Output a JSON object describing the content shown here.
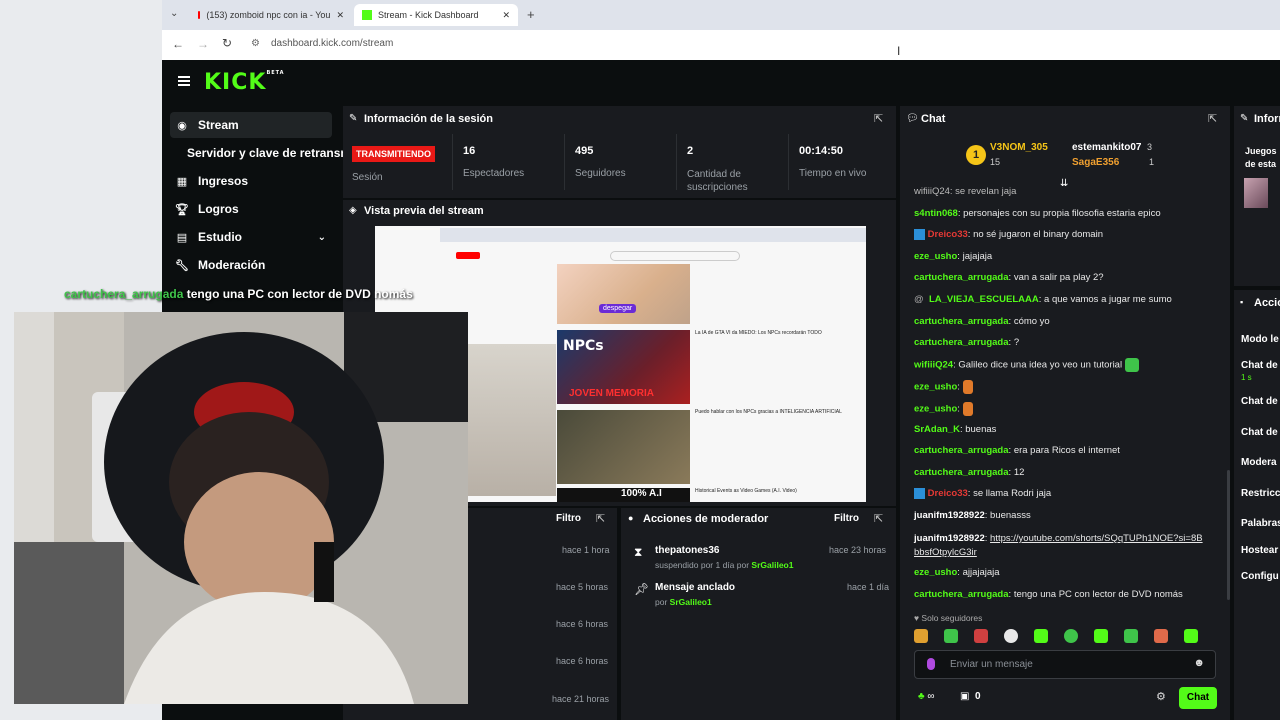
{
  "browser": {
    "tabs": [
      {
        "label": "(153) zomboid npc con ia - You",
        "active": false
      },
      {
        "label": "Stream - Kick Dashboard",
        "active": true
      }
    ],
    "new_tab": "+",
    "url": "dashboard.kick.com/stream"
  },
  "brand": {
    "logo": "KICK",
    "beta": "BETA",
    "accent": "#53fc18"
  },
  "sidebar": {
    "items": [
      {
        "label": "Stream",
        "icon": "stream-icon"
      },
      {
        "label": "Servidor y clave de retransm",
        "icon": ""
      },
      {
        "label": "Ingresos",
        "icon": "revenue-icon"
      },
      {
        "label": "Logros",
        "icon": "trophy-icon"
      },
      {
        "label": "Estudio",
        "icon": "studio-icon"
      },
      {
        "label": "Moderación",
        "icon": "wrench-icon"
      }
    ]
  },
  "session": {
    "title": "Información de la sesión",
    "status_badge": "TRANSMITIENDO",
    "status_label": "Sesión",
    "stats": [
      {
        "value": "16",
        "label": "Espectadores"
      },
      {
        "value": "495",
        "label": "Seguidores"
      },
      {
        "value": "2",
        "label": "Cantidad de suscripciones"
      },
      {
        "value": "00:14:50",
        "label": "Tiempo en vivo"
      }
    ]
  },
  "preview": {
    "title": "Vista previa del stream",
    "thumbs": [
      "despegar",
      "NPCs",
      "JOVEN MEMORIA",
      "100% A.I"
    ],
    "video_titles": [
      "La IA de GTA VI da MIEDO: Los NPCs recordarán TODO",
      "Puedo hablar con los NPCs gracias a INTELIGENCIA ARTIFICIAL",
      "Historical Events as Video Games (A.I. Video)"
    ]
  },
  "activity": {
    "filter": "Filtro",
    "times": [
      "hace 1 hora",
      "hace 5 horas",
      "hace 6 horas",
      "hace 6 horas",
      "hace 21 horas"
    ]
  },
  "mod_actions": {
    "title": "Acciones de moderador",
    "filter": "Filtro",
    "items": [
      {
        "user": "thepatones36",
        "detail": "suspendido por 1 día por",
        "by": "SrGalileo1",
        "time": "hace 23 horas"
      },
      {
        "user": "Mensaje anclado",
        "detail": "por",
        "by": "SrGalileo1",
        "time": "hace 1 día"
      }
    ]
  },
  "chat": {
    "title": "Chat",
    "top_gifter": {
      "rank": "1",
      "name": "V3NOM_305",
      "count": "15"
    },
    "gifters": [
      {
        "name": "estemankito07",
        "count": "3"
      },
      {
        "name": "SagaE356",
        "count": "1"
      }
    ],
    "partial_top": "wifiiiQ24: se revelan jaja",
    "messages": [
      {
        "user": "s4ntin068",
        "text": "personajes con su propia filosofia estaria epico",
        "color": "green"
      },
      {
        "user": "Dreico33",
        "text": "no sé jugaron el binary domain",
        "color": "red"
      },
      {
        "user": "eze_usho",
        "text": "jajajaja",
        "color": "green"
      },
      {
        "user": "cartuchera_arrugada",
        "text": "van a salir pa play 2?",
        "color": "green"
      },
      {
        "user": "LA_VIEJA_ESCUELAAA",
        "text": "a que vamos a jugar me sumo",
        "color": "green"
      },
      {
        "user": "cartuchera_arrugada",
        "text": "cómo yo",
        "color": "green"
      },
      {
        "user": "cartuchera_arrugada",
        "text": "?",
        "color": "green"
      },
      {
        "user": "wifiiiQ24",
        "text": "Galileo dice una idea yo veo un tutorial",
        "color": "green"
      },
      {
        "user": "eze_usho",
        "text": "",
        "color": "green"
      },
      {
        "user": "eze_usho",
        "text": "",
        "color": "green"
      },
      {
        "user": "SrAdan_K",
        "text": "buenas",
        "color": "green"
      },
      {
        "user": "cartuchera_arrugada",
        "text": "era para Ricos el internet",
        "color": "green"
      },
      {
        "user": "cartuchera_arrugada",
        "text": "12",
        "color": "green"
      },
      {
        "user": "Dreico33",
        "text": "se llama Rodri jaja",
        "color": "red"
      },
      {
        "user": "juanifm1928922",
        "text": "buenasss",
        "color": "white"
      },
      {
        "user": "juanifm1928922",
        "text": "https://youtube.com/shorts/SQqTUPh1NOE?si=8BbbsfOtpylcG3ir",
        "color": "white"
      },
      {
        "user": "eze_usho",
        "text": "ajjajajaja",
        "color": "green"
      },
      {
        "user": "cartuchera_arrugada",
        "text": "tengo una PC con lector de DVD nomás",
        "color": "green"
      }
    ],
    "followers_only": "Solo seguidores",
    "input_placeholder": "Enviar un mensaje",
    "send_label": "Chat",
    "bottom_counts": {
      "infinity": "∞",
      "gift": "0"
    }
  },
  "right_panels": {
    "info_title": "Inform",
    "info_sub": "Juegos de esta",
    "actions_title": "Accio",
    "actions": [
      "Modo le",
      "Chat de",
      "1 s",
      "Chat de",
      "Chat de",
      "Modera",
      "Restricc",
      "Palabras",
      "Hostear",
      "Configu"
    ]
  },
  "overlay": {
    "user": "cartuchera_arrugada",
    "text": "tengo una PC con lector de DVD nomás"
  }
}
